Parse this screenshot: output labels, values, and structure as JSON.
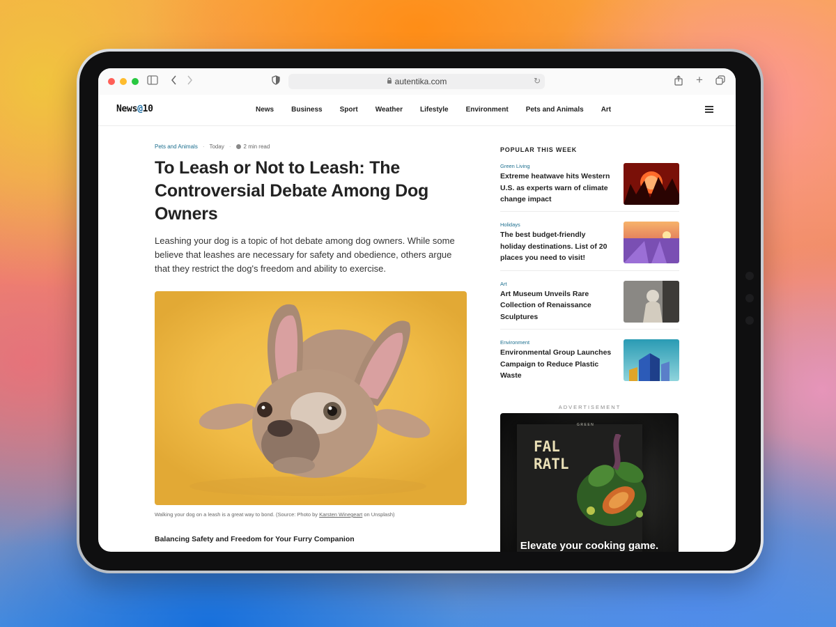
{
  "browser": {
    "url": "autentika.com"
  },
  "site": {
    "logo_prefix": "News",
    "logo_at": "@",
    "logo_suffix": "10",
    "nav": [
      "News",
      "Business",
      "Sport",
      "Weather",
      "Lifestyle",
      "Environment",
      "Pets and Animals",
      "Art"
    ]
  },
  "article": {
    "category": "Pets and Animals",
    "date": "Today",
    "read_time": "2 min read",
    "headline": "To Leash or Not to Leash: The Controversial Debate Among Dog Owners",
    "lead": "Leashing your dog is a topic of hot debate among dog owners. While some believe that leashes are necessary for safety and obedience, others argue that they restrict the dog's freedom and ability to exercise.",
    "caption_before": "Walking your dog on a leash is a great way to bond. (Source: Photo by ",
    "caption_credit": "Karsten Winegeart",
    "caption_after": " on Unsplash)",
    "subheading": "Balancing Safety and Freedom for Your Furry Companion"
  },
  "sidebar": {
    "popular_title": "POPULAR THIS WEEK",
    "items": [
      {
        "category": "Green Living",
        "headline": "Extreme heatwave hits Western U.S. as experts warn of climate change impact"
      },
      {
        "category": "Holidays",
        "headline": "The best budget-friendly holiday destinations. List of 20 places you need to visit!"
      },
      {
        "category": "Art",
        "headline": "Art Museum Unveils Rare Collection of Renaissance Sculptures"
      },
      {
        "category": "Environment",
        "headline": "Environmental Group Launches Campaign to Reduce Plastic Waste"
      }
    ],
    "ad_label": "ADVERTISEMENT",
    "ad": {
      "small_text": "GREEN",
      "big_line1": "FAL",
      "big_line2": "RATL",
      "cta": "Elevate your cooking game."
    }
  },
  "colors": {
    "accent": "#1d6f8f",
    "logo_at": "#1d6fa5",
    "hero_background": "#f0bb46"
  }
}
